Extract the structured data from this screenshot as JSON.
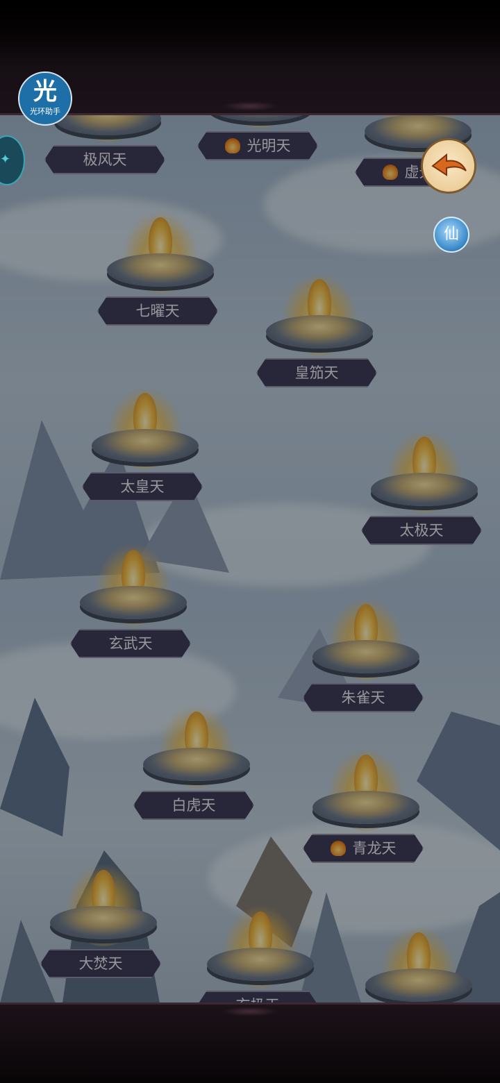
{
  "helper": {
    "glyph": "光",
    "label": "光环助手"
  },
  "buttons": {
    "immortal": "仙"
  },
  "nodes": [
    {
      "name": "极风天",
      "badge": false
    },
    {
      "name": "光明天",
      "badge": true
    },
    {
      "name": "虚无天",
      "badge": true
    },
    {
      "name": "七曜天",
      "badge": false
    },
    {
      "name": "皇笳天",
      "badge": false
    },
    {
      "name": "太皇天",
      "badge": false
    },
    {
      "name": "太极天",
      "badge": false
    },
    {
      "name": "玄武天",
      "badge": false
    },
    {
      "name": "朱雀天",
      "badge": false
    },
    {
      "name": "白虎天",
      "badge": false
    },
    {
      "name": "青龙天",
      "badge": true
    },
    {
      "name": "大焚天",
      "badge": false
    },
    {
      "name": "玄极天",
      "badge": false
    },
    {
      "name": "",
      "badge": false
    }
  ],
  "colors": {
    "label_bg": "#3e3b58",
    "label_text": "#e9e6ef",
    "frame": "#2c1d28"
  }
}
